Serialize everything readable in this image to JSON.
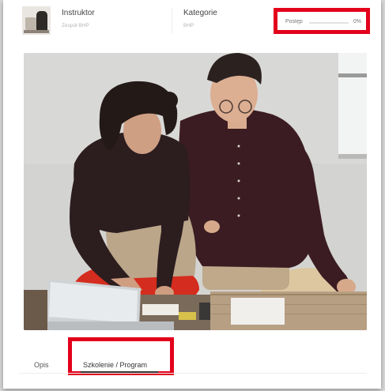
{
  "course_meta": {
    "instructor_label": "Instruktor",
    "instructor_name": "Zespół BHP",
    "category_label": "Kategorie",
    "category_value": "BHP",
    "progress_label": "Postęp",
    "progress_value": "0%",
    "progress_fraction": 0
  },
  "tabs": [
    {
      "label": "Opis"
    },
    {
      "label": "Szkolenie / Program"
    }
  ],
  "colors": {
    "highlight": "#e3001b",
    "active_underline": "#333333"
  }
}
